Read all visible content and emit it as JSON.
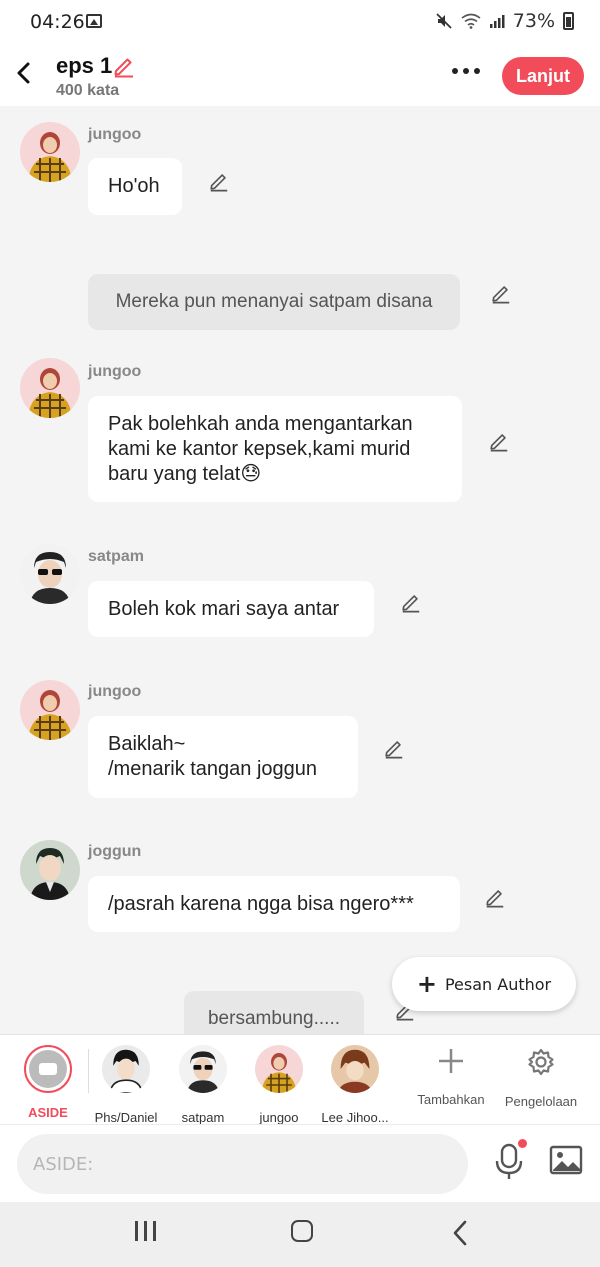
{
  "status": {
    "time": "04:26",
    "battery": "73%"
  },
  "header": {
    "title": "eps 1",
    "word_count": "400 kata",
    "continue_label": "Lanjut"
  },
  "chat": {
    "messages": [
      {
        "type": "dialog",
        "speaker": "jungoo",
        "text": "Ho'oh"
      },
      {
        "type": "narration",
        "text": "Mereka pun menanyai satpam disana"
      },
      {
        "type": "dialog",
        "speaker": "jungoo",
        "text": "Pak bolehkah anda mengantarkan\nkami ke kantor kepsek,kami murid\nbaru yang telat😓"
      },
      {
        "type": "dialog",
        "speaker": "satpam",
        "text": "Boleh kok mari saya antar"
      },
      {
        "type": "dialog",
        "speaker": "jungoo",
        "text": "Baiklah~\n/menarik tangan joggun"
      },
      {
        "type": "dialog",
        "speaker": "joggun",
        "text": "/pasrah karena ngga bisa ngero***"
      },
      {
        "type": "narration",
        "text": "bersambung....."
      }
    ],
    "author_message_label": "Pesan Author"
  },
  "characters": {
    "items": [
      {
        "label": "ASIDE",
        "active": true
      },
      {
        "label": "Phs/Daniel"
      },
      {
        "label": "satpam"
      },
      {
        "label": "jungoo"
      },
      {
        "label": "Lee Jihoo..."
      }
    ],
    "add_label": "Tambahkan",
    "manage_label": "Pengelolaan"
  },
  "composer": {
    "placeholder": "ASIDE:"
  },
  "colors": {
    "accent": "#f24c5a",
    "background": "#f4f4f4",
    "bubble": "#ffffff",
    "narration": "#e7e7e7"
  },
  "icons": [
    "back-icon",
    "pencil-icon",
    "more-icon",
    "plus-icon",
    "gear-icon",
    "mic-icon",
    "image-icon"
  ]
}
